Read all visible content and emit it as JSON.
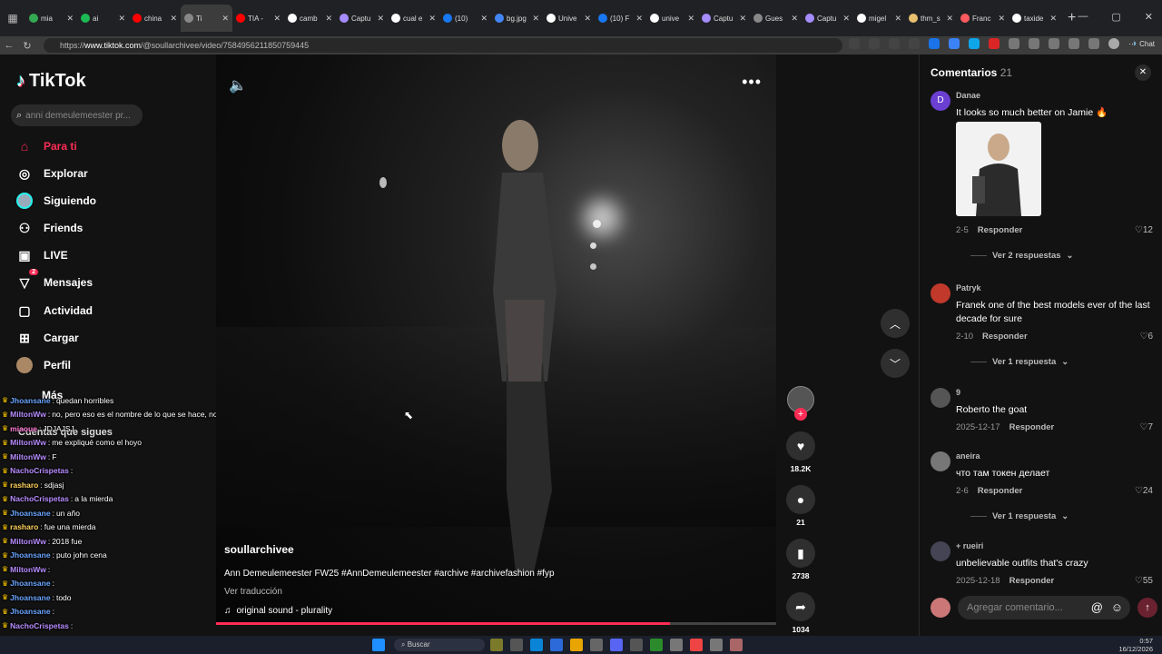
{
  "browser": {
    "tabs": [
      {
        "title": "mia",
        "color": "#34a853"
      },
      {
        "title": "ai",
        "color": "#1db954"
      },
      {
        "title": "china",
        "color": "#ff0000"
      },
      {
        "title": "Ti",
        "color": "#888888",
        "active": true
      },
      {
        "title": "TIA -",
        "color": "#ff0000"
      },
      {
        "title": "camb",
        "color": "#ffffff"
      },
      {
        "title": "Captu",
        "color": "#a58cff"
      },
      {
        "title": "cual e",
        "color": "#ffffff"
      },
      {
        "title": "(10)",
        "color": "#1877f2"
      },
      {
        "title": "bg.jpg",
        "color": "#4285f4"
      },
      {
        "title": "Unive",
        "color": "#ffffff"
      },
      {
        "title": "(10) F",
        "color": "#1877f2"
      },
      {
        "title": "unive",
        "color": "#ffffff"
      },
      {
        "title": "Captu",
        "color": "#a58cff"
      },
      {
        "title": "Gues",
        "color": "#888888"
      },
      {
        "title": "Captu",
        "color": "#a58cff"
      },
      {
        "title": "migel",
        "color": "#ffffff"
      },
      {
        "title": "thm_s",
        "color": "#e8c070"
      },
      {
        "title": "Franc",
        "color": "#ff5a5f"
      },
      {
        "title": "taxide",
        "color": "#ffffff"
      }
    ],
    "new_tab": "+",
    "url_prefix": "https://",
    "url_host": "www.tiktok.com",
    "url_path": "/@soullarchivee/video/7584956211850759445",
    "chat_label": "Chat"
  },
  "sidebar": {
    "logo": "TikTok",
    "search_placeholder": "anni demeulemeester pr...",
    "items": [
      {
        "label": "Para ti",
        "icon": "home-icon",
        "glyph": "⌂"
      },
      {
        "label": "Explorar",
        "icon": "compass-icon",
        "glyph": "◎"
      },
      {
        "label": "Siguiendo",
        "icon": "following-avatar-icon",
        "glyph": ""
      },
      {
        "label": "Friends",
        "icon": "friends-icon",
        "glyph": "⚇"
      },
      {
        "label": "LIVE",
        "icon": "live-icon",
        "glyph": "▣"
      },
      {
        "label": "Mensajes",
        "icon": "messages-icon",
        "glyph": "▽",
        "badge": "2"
      },
      {
        "label": "Actividad",
        "icon": "activity-icon",
        "glyph": "▢"
      },
      {
        "label": "Cargar",
        "icon": "upload-icon",
        "glyph": "⊞"
      },
      {
        "label": "Perfil",
        "icon": "profile-icon",
        "glyph": ""
      }
    ],
    "more_label": "Más",
    "following_heading": "Cuentas que sigues"
  },
  "stream_chat": [
    {
      "user": "Jhoansane",
      "color": "#6aa5ff",
      "text": "quedan horribles"
    },
    {
      "user": "MiltonWw",
      "color": "#b78cff",
      "text": "no, pero eso es el nombre de lo que se hace, no la acción de hacerlo"
    },
    {
      "user": "miaoue",
      "color": "#ff7bd5",
      "text": "JDJAJSJ"
    },
    {
      "user": "MiltonWw",
      "color": "#b78cff",
      "text": "me expliqué como el hoyo"
    },
    {
      "user": "MiltonWw",
      "color": "#b78cff",
      "text": "F"
    },
    {
      "user": "NachoCrispetas",
      "color": "#b78cff",
      "text": ""
    },
    {
      "user": "rasharo",
      "color": "#ffd25a",
      "text": "sdjasj"
    },
    {
      "user": "NachoCrispetas",
      "color": "#b78cff",
      "text": "a la mierda"
    },
    {
      "user": "Jhoansane",
      "color": "#6aa5ff",
      "text": "un año"
    },
    {
      "user": "rasharo",
      "color": "#ffd25a",
      "text": "fue una mierda"
    },
    {
      "user": "MiltonWw",
      "color": "#b78cff",
      "text": "2018 fue"
    },
    {
      "user": "Jhoansane",
      "color": "#6aa5ff",
      "text": "puto john cena"
    },
    {
      "user": "MiltonWw",
      "color": "#b78cff",
      "text": ""
    },
    {
      "user": "Jhoansane",
      "color": "#6aa5ff",
      "text": ""
    },
    {
      "user": "Jhoansane",
      "color": "#6aa5ff",
      "text": "todo"
    },
    {
      "user": "Jhoansane",
      "color": "#6aa5ff",
      "text": ""
    },
    {
      "user": "NachoCrispetas",
      "color": "#b78cff",
      "text": ""
    },
    {
      "user": "NachoCrispetas",
      "color": "#b78cff",
      "text": ""
    }
  ],
  "video": {
    "author": "soullarchivee",
    "description": "Ann Demeulemeester FW25 #AnnDemeulemeester #archive #archivefashion #fyp",
    "translate": "Ver traducción",
    "sound": "original sound - plurality",
    "progress": 0.81
  },
  "actions": {
    "likes": "18.2K",
    "comments": "21",
    "saves": "2738",
    "shares": "1034"
  },
  "comments": {
    "title": "Comentarios",
    "count": "21",
    "input_placeholder": "Agregar comentario...",
    "items": [
      {
        "name": "Danae",
        "initial": "D",
        "avatar_color": "#6a3fd1",
        "text": "It looks so much better on Jamie 🔥",
        "date": "2-5",
        "reply": "Responder",
        "likes": "12",
        "more": "Ver 2 respuestas",
        "has_image": true
      },
      {
        "name": "Patryk",
        "initial": "",
        "avatar_color": "#c0392b",
        "text": "Franek one of the best models ever of the last decade for sure",
        "date": "2-10",
        "reply": "Responder",
        "likes": "6",
        "more": "Ver 1 respuesta"
      },
      {
        "name": "9",
        "initial": "",
        "avatar_color": "#555555",
        "text": "Roberto the goat",
        "date": "2025-12-17",
        "reply": "Responder",
        "likes": "7"
      },
      {
        "name": "aneira",
        "initial": "",
        "avatar_color": "#777777",
        "text": "что там токен делает",
        "date": "2-6",
        "reply": "Responder",
        "likes": "24",
        "more": "Ver 1 respuesta"
      },
      {
        "name": "+ rueiri",
        "initial": "",
        "avatar_color": "#445",
        "text": "unbelievable outfits that's crazy",
        "date": "2025-12-18",
        "reply": "Responder",
        "likes": "55"
      }
    ]
  },
  "taskbar": {
    "search": "Buscar",
    "time": "0:57",
    "date": "16/12/2026"
  }
}
